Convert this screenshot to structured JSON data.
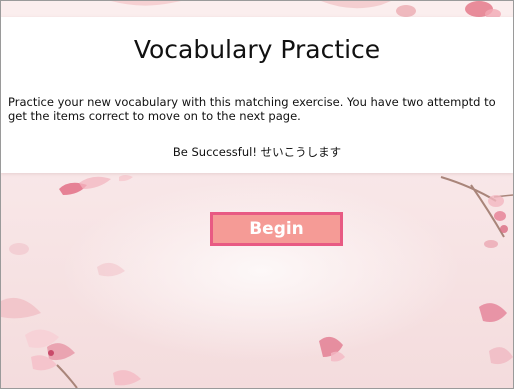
{
  "page": {
    "title": "Vocabulary Practice",
    "instructions": "Practice your new vocabulary with this matching exercise. You have two attemptd to get the items correct to move on to the next page.",
    "motto": "Be Successful! せいこうします",
    "begin_label": "Begin"
  },
  "colors": {
    "accent_fill": "#f59b96",
    "accent_border": "#e85a83",
    "background_tint": "#f8e6e7"
  },
  "decoration": {
    "theme": "cherry-blossom"
  }
}
